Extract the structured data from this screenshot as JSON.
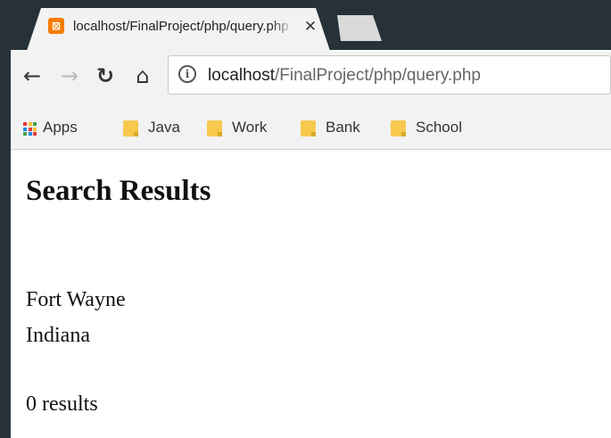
{
  "tab": {
    "favicon": "xampp-icon",
    "favicon_glyph": "⊠",
    "title": "localhost/FinalProject/php/query.php",
    "close_glyph": "✕"
  },
  "toolbar": {
    "back_glyph": "←",
    "forward_glyph": "→",
    "reload_glyph": "↻",
    "home_glyph": "⌂",
    "info_glyph": "i",
    "url_host": "localhost",
    "url_path": "/FinalProject/php/query.php"
  },
  "bookmarks": [
    {
      "label": "Apps",
      "icon": "apps-icon"
    },
    {
      "label": "Java",
      "icon": "folder-icon"
    },
    {
      "label": "Work",
      "icon": "folder-icon"
    },
    {
      "label": "Bank",
      "icon": "folder-icon"
    },
    {
      "label": "School",
      "icon": "folder-icon"
    }
  ],
  "colors": {
    "background_frame": "#263238",
    "tab_active": "#f2f2f2",
    "folder": "#f6c94d",
    "apps_dots": [
      "#e53935",
      "#fbc02d",
      "#43a047",
      "#1e88e5"
    ]
  },
  "page": {
    "heading": "Search Results",
    "city": "Fort Wayne",
    "state": "Indiana",
    "result_count": "0 results"
  }
}
